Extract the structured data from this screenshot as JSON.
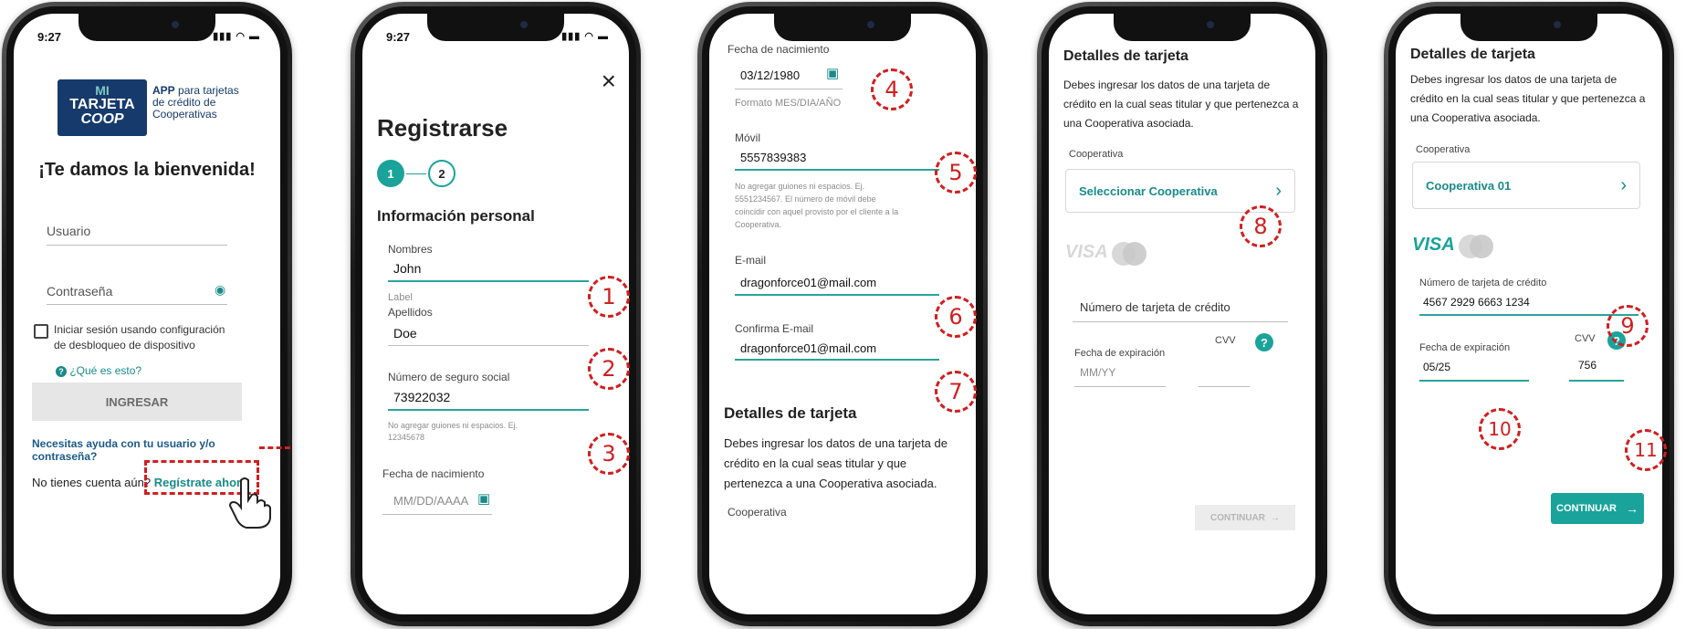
{
  "screen1": {
    "time": "9:27",
    "logo": {
      "line1": "MI",
      "line2": "TARJETA",
      "line3": "COOP",
      "tagline_bold": "APP",
      "tagline": "para tarjetas de crédito de Cooperativas"
    },
    "welcome": "¡Te damos la bienvenida!",
    "username_label": "Usuario",
    "password_label": "Contraseña",
    "unlock_checkbox": "Iniciar sesión usando configuración de desbloqueo de dispositivo",
    "what_is_this": "¿Qué es esto?",
    "login_button": "INGRESAR",
    "help_link": "Necesitas ayuda con tu usuario y/o contraseña?",
    "no_account": "No tienes cuenta aún?",
    "register_link": "Regístrate ahora"
  },
  "screen2": {
    "time": "9:27",
    "close": "×",
    "title": "Registrarse",
    "steps": [
      "1",
      "2"
    ],
    "section": "Información personal",
    "names_label": "Nombres",
    "names_value": "John",
    "label_text": "Label",
    "surname_label": "Apellidos",
    "surname_value": "Doe",
    "ssn_label": "Número de seguro social",
    "ssn_value": "73922032",
    "ssn_hint": "No agregar guiones ni espacios. Ej. 12345678",
    "birth_label": "Fecha de nacimiento",
    "birth_placeholder": "MM/DD/AAAA"
  },
  "screen3": {
    "birth_label": "Fecha de nacimiento",
    "birth_value": "03/12/1980",
    "birth_format": "Formato MES/DIA/AÑO",
    "mobile_label": "Móvil",
    "mobile_value": "5557839383",
    "mobile_hint": "No agregar guiones ni espacios. Ej. 5551234567. El número de móvil debe coincidir con aquel provisto por el cliente a la Cooperativa.",
    "email_label": "E-mail",
    "email_value": "dragonforce01@mail.com",
    "confirm_label": "Confirma E-mail",
    "confirm_value": "dragonforce01@mail.com",
    "card_title": "Detalles de tarjeta",
    "card_text": "Debes ingresar los datos de una tarjeta de crédito en la cual seas titular y que pertenezca a una Cooperativa asociada.",
    "coop_label": "Cooperativa"
  },
  "screen4": {
    "title": "Detalles de tarjeta",
    "text": "Debes ingresar los datos de una tarjeta de crédito en la cual seas titular y que pertenezca a una Cooperativa asociada.",
    "coop_label": "Cooperativa",
    "coop_select": "Seleccionar Cooperativa",
    "visa": "VISA",
    "card_number_placeholder": "Número de tarjeta de crédito",
    "expiry_label": "Fecha de expiración",
    "expiry_placeholder": "MM/YY",
    "cvv_label": "CVV",
    "help": "?",
    "continue": "CONTINUAR"
  },
  "screen5": {
    "title": "Detalles de tarjeta",
    "text": "Debes ingresar los datos de una tarjeta de crédito en la cual seas titular y que pertenezca a una Cooperativa asociada.",
    "coop_label": "Cooperativa",
    "coop_value": "Cooperativa 01",
    "visa": "VISA",
    "card_number_label": "Número de tarjeta de crédito",
    "card_number_value": "4567 2929 6663 1234",
    "expiry_label": "Fecha de expiración",
    "expiry_value": "05/25",
    "cvv_label": "CVV",
    "cvv_value": "756",
    "help": "?",
    "continue": "CONTINUAR"
  },
  "markers": [
    "1",
    "2",
    "3",
    "4",
    "5",
    "6",
    "7",
    "8",
    "9",
    "10",
    "11"
  ],
  "colors": {
    "teal": "#1aa39a",
    "annotation_red": "#d01f1f"
  }
}
